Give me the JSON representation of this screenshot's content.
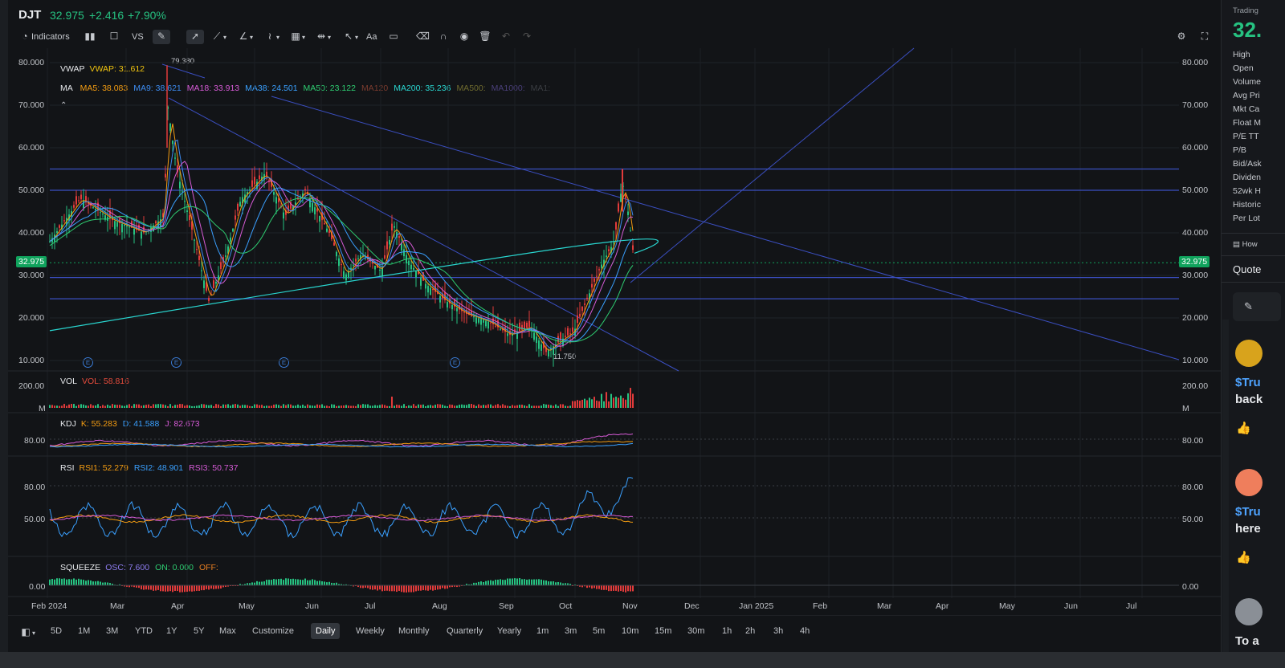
{
  "header": {
    "symbol": "DJT",
    "price": "32.975",
    "change": "+2.416",
    "change_pct": "+7.90%"
  },
  "toolbar": {
    "indicators_label": "Indicators",
    "compare_label": "VS",
    "text_tool_label": "Aa"
  },
  "legends": {
    "vwap": {
      "label": "VWAP",
      "value": "VWAP: 31.612"
    },
    "ma": {
      "label": "MA",
      "items": [
        {
          "text": "MA5: 38.083",
          "color": "#f39c12"
        },
        {
          "text": "MA9: 38.621",
          "color": "#3d8bf0"
        },
        {
          "text": "MA18: 33.913",
          "color": "#d65bd6"
        },
        {
          "text": "MA38: 24.501",
          "color": "#3aa0ff"
        },
        {
          "text": "MA50: 23.122",
          "color": "#2ecc71"
        },
        {
          "text": "MA120",
          "color": "#7a3b2e"
        },
        {
          "text": "MA200: 35.236",
          "color": "#29d6d0"
        },
        {
          "text": "MA500:",
          "color": "#6e6a2e"
        },
        {
          "text": "MA1000:",
          "color": "#4a3f7a"
        },
        {
          "text": "MA1:",
          "color": "#3a3d42"
        }
      ]
    },
    "vol": {
      "label": "VOL",
      "value": "VOL: 58.816"
    },
    "kdj": {
      "label": "KDJ",
      "k": "K: 55.283",
      "d": "D: 41.588",
      "j": "J: 82.673"
    },
    "rsi": {
      "label": "RSI",
      "rsi1": "RSI1: 52.279",
      "rsi2": "RSI2: 48.901",
      "rsi3": "RSI3: 50.737"
    },
    "squeeze": {
      "label": "SQUEEZE",
      "osc": "OSC: 7.600",
      "on": "ON: 0.000",
      "off": "OFF:"
    }
  },
  "annotations": {
    "high_label": "79.380",
    "low_label": "11.750",
    "earnings_marker": "E"
  },
  "price_axis": {
    "left": [
      "80.000",
      "70.000",
      "60.000",
      "50.000",
      "40.000",
      "30.000",
      "20.000",
      "10.000"
    ],
    "right": [
      "80.000",
      "70.000",
      "60.000",
      "50.000",
      "40.000",
      "30.000",
      "20.000",
      "10.000"
    ],
    "current": "32.975"
  },
  "vol_axis": {
    "top": "200.00",
    "unit": "M"
  },
  "kdj_axis": {
    "level": "80.00"
  },
  "rsi_axis": {
    "top": "80.00",
    "mid": "50.00"
  },
  "squeeze_axis": {
    "zero": "0.00"
  },
  "x_axis": [
    "Feb 2024",
    "Mar",
    "Apr",
    "May",
    "Jun",
    "Jul",
    "Aug",
    "Sep",
    "Oct",
    "Nov",
    "Dec",
    "Jan 2025",
    "Feb",
    "Mar",
    "Apr",
    "May",
    "Jun",
    "Jul"
  ],
  "timeframes": [
    "5D",
    "1M",
    "3M",
    "YTD",
    "1Y",
    "5Y",
    "Max",
    "Customize",
    "Daily",
    "Weekly",
    "Monthly",
    "Quarterly",
    "Yearly",
    "1m",
    "3m",
    "5m",
    "10m",
    "15m",
    "30m",
    "1h",
    "2h",
    "3h",
    "4h"
  ],
  "selected_timeframe": "Daily",
  "right_panel": {
    "title": "Trading",
    "price": "32.",
    "stats": [
      "High",
      "Open",
      "Volume",
      "Avg Pri",
      "Mkt Ca",
      "Float M",
      "P/E TT",
      "P/B",
      "Bid/Ask",
      "Dividen",
      "52wk H",
      "Historic",
      "Per Lot"
    ],
    "how_label": "How",
    "quote_label": "Quote",
    "posts": [
      {
        "title": "$Tru",
        "body": "back"
      },
      {
        "title": "$Tru",
        "body": "here"
      },
      {
        "title": "To a",
        "body": ""
      }
    ]
  },
  "chart_data": {
    "type": "candlestick",
    "title": "DJT",
    "x_range": [
      "Feb 2024",
      "Jul 2025"
    ],
    "ylim": [
      10,
      80
    ],
    "series": [
      {
        "name": "Close",
        "x": [
          "Feb 2024",
          "Mar",
          "Apr",
          "May",
          "Jun",
          "Jul",
          "Aug",
          "Sep",
          "Oct",
          "Nov"
        ],
        "values": [
          38,
          41,
          64,
          28,
          50,
          33,
          28,
          17,
          18,
          32.975
        ]
      }
    ],
    "high": 79.38,
    "low": 11.75,
    "horizontal_levels": [
      55,
      50,
      29.5,
      24.5
    ]
  }
}
